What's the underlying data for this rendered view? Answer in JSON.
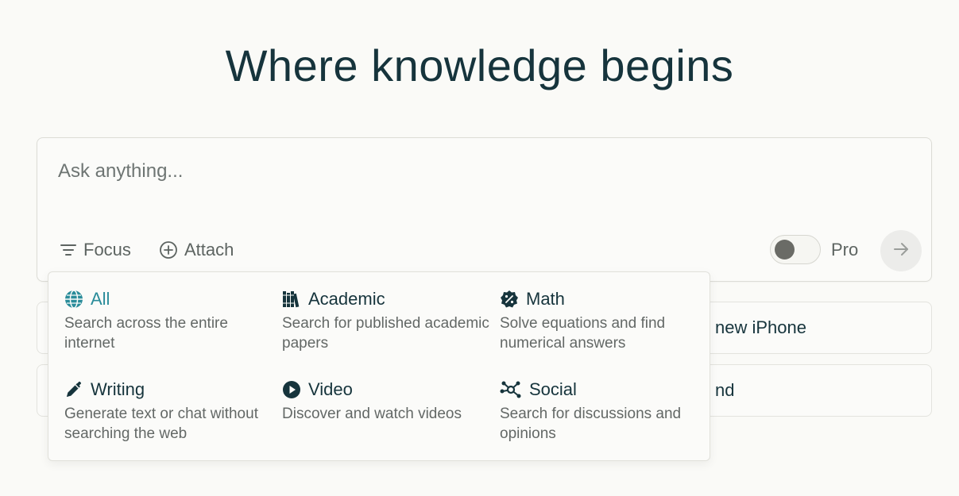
{
  "headline": "Where knowledge begins",
  "ask": {
    "placeholder": "Ask anything...",
    "focus_label": "Focus",
    "attach_label": "Attach",
    "pro_label": "Pro",
    "pro_enabled": false
  },
  "suggestions": [
    {
      "text": "new iPhone"
    },
    {
      "text": "nd"
    }
  ],
  "focus_menu": {
    "active": "All",
    "options": [
      {
        "label": "All",
        "description": "Search across the entire internet",
        "icon": "globe-icon"
      },
      {
        "label": "Academic",
        "description": "Search for published academic papers",
        "icon": "books-icon"
      },
      {
        "label": "Math",
        "description": "Solve equations and find numerical answers",
        "icon": "percent-badge-icon"
      },
      {
        "label": "Writing",
        "description": "Generate text or chat without searching the web",
        "icon": "pencil-icon"
      },
      {
        "label": "Video",
        "description": "Discover and watch videos",
        "icon": "play-icon"
      },
      {
        "label": "Social",
        "description": "Search for discussions and opinions",
        "icon": "network-icon"
      }
    ]
  },
  "colors": {
    "background": "#fafaf7",
    "accent": "#2a8c9a",
    "text": "#16343c"
  }
}
